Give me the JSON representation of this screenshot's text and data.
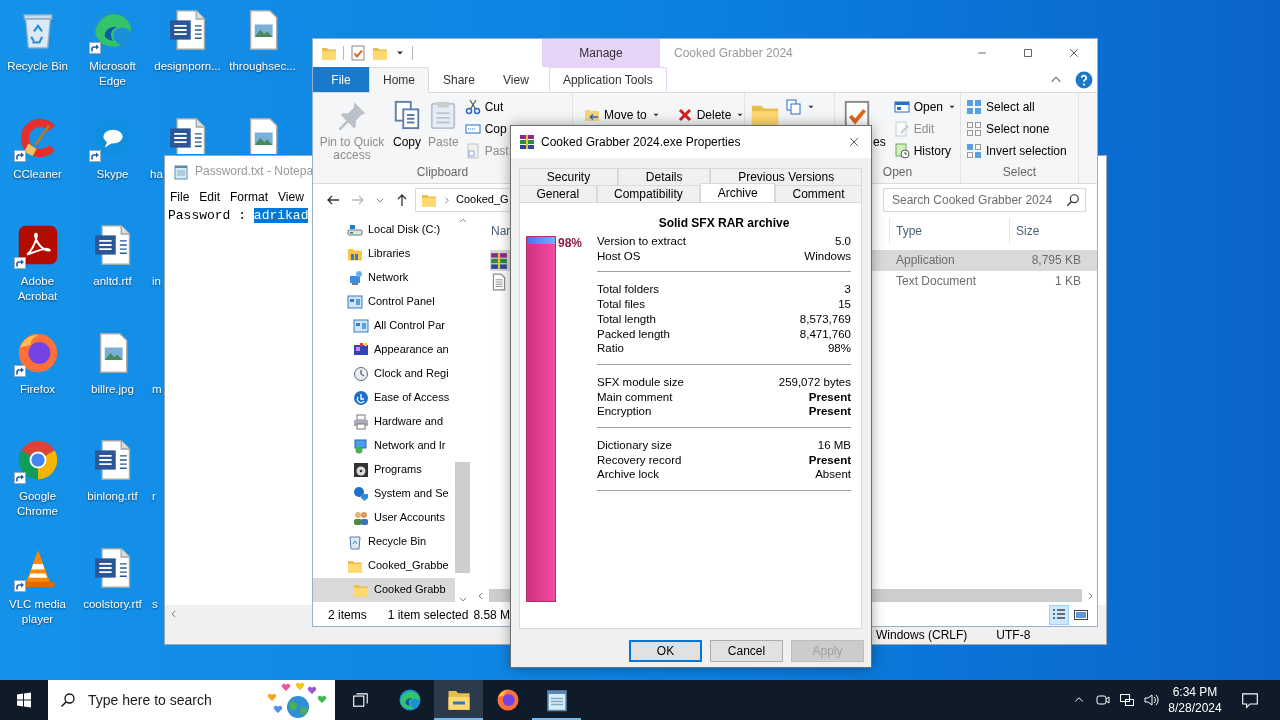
{
  "desktop": {
    "columns": [
      [
        {
          "label": "Recycle Bin",
          "kind": "recycle",
          "shortcut": false
        },
        {
          "label": "CCleaner",
          "kind": "ccleaner",
          "shortcut": true
        },
        {
          "label": "Adobe Acrobat",
          "kind": "acrobat",
          "shortcut": true
        },
        {
          "label": "Firefox",
          "kind": "firefox",
          "shortcut": true
        },
        {
          "label": "Google Chrome",
          "kind": "chrome",
          "shortcut": true
        },
        {
          "label": "VLC media player",
          "kind": "vlc",
          "shortcut": true
        }
      ],
      [
        {
          "label": "Microsoft Edge",
          "kind": "edge",
          "shortcut": true
        },
        {
          "label": "Skype",
          "kind": "skype",
          "shortcut": true
        },
        {
          "label": "anltd.rtf",
          "kind": "word",
          "shortcut": false
        },
        {
          "label": "billre.jpg",
          "kind": "image",
          "shortcut": false
        },
        {
          "label": "binlong.rtf",
          "kind": "word",
          "shortcut": false
        },
        {
          "label": "coolstory.rtf",
          "kind": "word",
          "shortcut": false
        }
      ],
      [
        {
          "label": "designporn...",
          "kind": "word",
          "shortcut": false
        },
        {
          "label": "ha",
          "kind": "word",
          "shortcut": false
        },
        {
          "label": "in"
        },
        {
          "label": "m"
        },
        {
          "label": "r"
        },
        {
          "label": "s"
        }
      ],
      [
        {
          "label": "throughsec...",
          "kind": "image",
          "shortcut": false
        },
        {
          "kind": "image",
          "shortcut": false
        }
      ]
    ]
  },
  "notepad": {
    "title": "Password.txt - Notepa",
    "menu": [
      "File",
      "Edit",
      "Format",
      "View"
    ],
    "text": "Password :",
    "selection": "adrikad",
    "status": [
      "Windows (CRLF)",
      "UTF-8"
    ]
  },
  "explorer": {
    "context_tab": "Manage",
    "title": "Cooked Grabber 2024",
    "tabs": [
      {
        "label": "File",
        "kind": "file",
        "selected": false
      },
      {
        "label": "Home",
        "kind": "main",
        "selected": true
      },
      {
        "label": "Share",
        "kind": "main",
        "selected": false
      },
      {
        "label": "View",
        "kind": "main",
        "selected": false
      },
      {
        "label": "Application Tools",
        "kind": "contextual",
        "selected": false
      }
    ],
    "ribbon": [
      {
        "label": "Clipboard",
        "kind": "stacked",
        "large": [
          {
            "label": "Pin to Quick access",
            "kind": "pin",
            "disabled": true
          },
          {
            "label": "Copy",
            "kind": "copy",
            "disabled": false
          },
          {
            "label": "Paste",
            "kind": "paste",
            "disabled": true
          }
        ],
        "small": [
          {
            "label": "Cut",
            "kind": "cut",
            "dropdown": false,
            "disabled": false
          },
          {
            "label": "Cop",
            "kind": "copypath",
            "dropdown": false,
            "disabled": false
          },
          {
            "label": "Past",
            "kind": "shortcut",
            "dropdown": false,
            "disabled": true
          }
        ]
      },
      {
        "kind": "row",
        "small": [
          {
            "label": "Move to",
            "kind": "moveto",
            "dropdown": true,
            "disabled": false
          },
          {
            "label": "Delete",
            "kind": "delete",
            "dropdown": true,
            "disabled": false
          }
        ]
      },
      {
        "kind": "stacked",
        "large": [
          {
            "kind": "folder",
            "disabled": false
          }
        ],
        "small": [
          {
            "kind": "copyto",
            "dropdown": true,
            "disabled": false
          }
        ]
      },
      {
        "label": "Open",
        "kind": "stacked",
        "large": [
          {
            "label": "es",
            "kind": "properties",
            "disabled": false
          }
        ],
        "small": [
          {
            "label": "Open",
            "kind": "open",
            "dropdown": true,
            "disabled": false
          },
          {
            "label": "Edit",
            "kind": "edit",
            "dropdown": false,
            "disabled": true
          },
          {
            "label": "History",
            "kind": "history",
            "dropdown": false,
            "disabled": false
          }
        ]
      },
      {
        "label": "Select",
        "kind": "stacked",
        "small": [
          {
            "label": "Select all",
            "kind": "selectall",
            "dropdown": false,
            "disabled": false
          },
          {
            "label": "Select none",
            "kind": "selectnone",
            "dropdown": false,
            "disabled": false
          },
          {
            "label": "Invert selection",
            "kind": "invert",
            "dropdown": false,
            "disabled": false
          }
        ]
      }
    ],
    "address": "Cooked_G",
    "search_placeholder": "Search Cooked Grabber 2024",
    "nav": [
      {
        "label": "Local Disk (C:)",
        "kind": "disk",
        "selected": false
      },
      {
        "label": "Libraries",
        "kind": "libraries",
        "selected": false
      },
      {
        "label": "Network",
        "kind": "network",
        "selected": false
      },
      {
        "label": "Control Panel",
        "kind": "controlpanel",
        "selected": false,
        "children": [
          {
            "label": "All Control Par",
            "kind": "controlpanel",
            "selected": false
          },
          {
            "label": "Appearance an",
            "kind": "appearance",
            "selected": false
          },
          {
            "label": "Clock and Regi",
            "kind": "clock",
            "selected": false
          },
          {
            "label": "Ease of Access",
            "kind": "ease",
            "selected": false
          },
          {
            "label": "Hardware and",
            "kind": "hardware",
            "selected": false
          },
          {
            "label": "Network and Ir",
            "kind": "netinternet",
            "selected": false
          },
          {
            "label": "Programs",
            "kind": "programs",
            "selected": false
          },
          {
            "label": "System and Se",
            "kind": "system",
            "selected": false
          },
          {
            "label": "User Accounts",
            "kind": "users",
            "selected": false
          }
        ]
      },
      {
        "label": "Recycle Bin",
        "kind": "recyclesm",
        "selected": false
      },
      {
        "label": "Cooked_Grabbe",
        "kind": "folder",
        "selected": false,
        "children": [
          {
            "label": "Cooked Grabb",
            "kind": "folder",
            "selected": true
          }
        ]
      }
    ],
    "columns": [
      "Nar",
      "Type",
      "Size"
    ],
    "rows": [
      {
        "kind": "archive",
        "type": "Application",
        "size": "8,795 KB",
        "selected": true
      },
      {
        "kind": "textfile",
        "type": "Text Document",
        "size": "1 KB",
        "selected": false
      }
    ],
    "status": [
      "2 items",
      "1 item selected",
      "8.58 M"
    ],
    "views": [
      {
        "kind": "details",
        "selected": true
      },
      {
        "kind": "tiles",
        "selected": false
      }
    ]
  },
  "dialog": {
    "title": "Cooked Grabber 2024.exe Properties",
    "tab_rows": [
      [
        {
          "label": "Security",
          "selected": false
        },
        {
          "label": "Details",
          "selected": false
        },
        {
          "label": "Previous Versions",
          "selected": false
        }
      ],
      [
        {
          "label": "General",
          "selected": false
        },
        {
          "label": "Compatibility",
          "selected": false
        },
        {
          "label": "Archive",
          "selected": true
        },
        {
          "label": "Comment",
          "selected": false
        }
      ]
    ],
    "heading": "Solid SFX RAR archive",
    "meter": {
      "level": 0.98,
      "reading": "98%"
    },
    "groups": [
      [
        {
          "label": "Version to extract",
          "value": "5.0",
          "strong": false
        },
        {
          "label": "Host OS",
          "value": "Windows",
          "strong": false
        }
      ],
      [
        {
          "label": "Total folders",
          "value": "3",
          "strong": false
        },
        {
          "label": "Total files",
          "value": "15",
          "strong": false
        },
        {
          "label": "Total length",
          "value": "8,573,769",
          "strong": false
        },
        {
          "label": "Packed length",
          "value": "8,471,760",
          "strong": false
        },
        {
          "label": "Ratio",
          "value": "98%",
          "strong": false
        }
      ],
      [
        {
          "label": "SFX module size",
          "value": "259,072 bytes",
          "strong": false
        },
        {
          "label": "Main comment",
          "value": "Present",
          "strong": true
        },
        {
          "label": "Encryption",
          "value": "Present",
          "strong": true
        }
      ],
      [
        {
          "label": "Dictionary size",
          "value": "16 MB",
          "strong": false
        },
        {
          "label": "Recovery record",
          "value": "Present",
          "strong": true
        },
        {
          "label": "Archive lock",
          "value": "Absent",
          "strong": false
        }
      ]
    ],
    "buttons": [
      {
        "label": "OK",
        "default": true,
        "disabled": false
      },
      {
        "label": "Cancel",
        "default": false,
        "disabled": false
      },
      {
        "label": "Apply",
        "default": false,
        "disabled": true
      }
    ]
  },
  "taskbar": {
    "search_placeholder": "Type here to search",
    "apps": [
      {
        "kind": "taskview",
        "running": false,
        "active": false
      },
      {
        "kind": "edge",
        "running": false,
        "active": false
      },
      {
        "kind": "tfolder",
        "running": true,
        "active": true
      },
      {
        "kind": "firefox",
        "running": false,
        "active": false
      },
      {
        "kind": "notepad",
        "running": true,
        "active": false
      }
    ],
    "time": "6:34 PM",
    "date": "8/28/2024"
  }
}
